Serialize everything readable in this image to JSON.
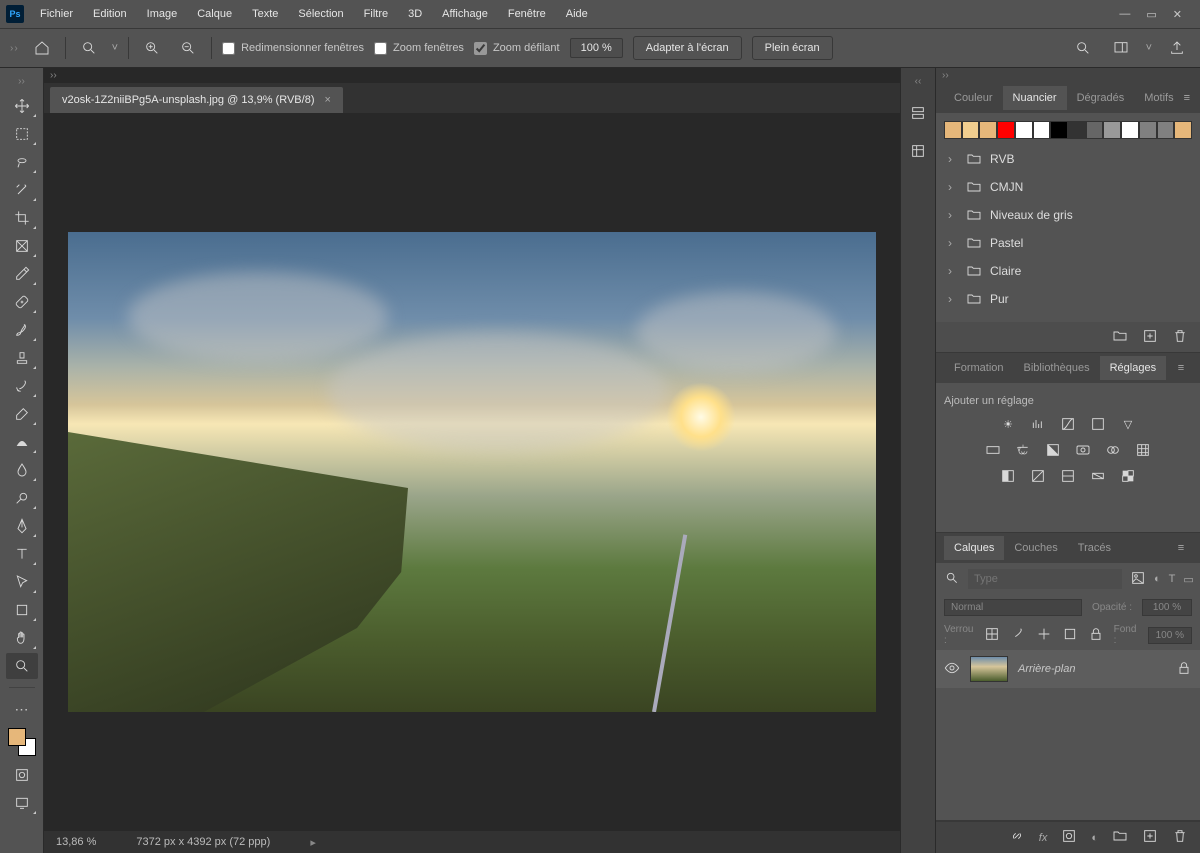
{
  "menu": [
    "Fichier",
    "Edition",
    "Image",
    "Calque",
    "Texte",
    "Sélection",
    "Filtre",
    "3D",
    "Affichage",
    "Fenêtre",
    "Aide"
  ],
  "options": {
    "resize_windows": "Redimensionner fenêtres",
    "zoom_windows": "Zoom fenêtres",
    "scrubby_zoom": "Zoom défilant",
    "zoom_value": "100 %",
    "fit_screen": "Adapter à l'écran",
    "full_screen": "Plein écran"
  },
  "doc": {
    "tab": "v2osk-1Z2niiBPg5A-unsplash.jpg @ 13,9% (RVB/8)",
    "status_zoom": "13,86 %",
    "status_dims": "7372 px x 4392 px (72 ppp)"
  },
  "swatch_panel": {
    "tabs": [
      "Couleur",
      "Nuancier",
      "Dégradés",
      "Motifs"
    ],
    "active": 1,
    "colors": [
      "#e6b77a",
      "#f0cd8e",
      "#e6b77a",
      "#ff0000",
      "#ffffff",
      "#ffffff",
      "#000000",
      "#333333",
      "#666666",
      "#999999",
      "#ffffff",
      "#808080",
      "#808080",
      "#e6b77a"
    ],
    "folders": [
      "RVB",
      "CMJN",
      "Niveaux de gris",
      "Pastel",
      "Claire",
      "Pur"
    ]
  },
  "middle_panel": {
    "tabs": [
      "Formation",
      "Bibliothèques",
      "Réglages"
    ],
    "active": 2,
    "label": "Ajouter un réglage"
  },
  "layers_panel": {
    "tabs": [
      "Calques",
      "Couches",
      "Tracés"
    ],
    "active": 0,
    "filter_placeholder": "Type",
    "blend_mode": "Normal",
    "opacity_label": "Opacité :",
    "opacity": "100 %",
    "lock_label": "Verrou :",
    "fill_label": "Fond :",
    "fill": "100 %",
    "layer_name": "Arrière-plan"
  }
}
